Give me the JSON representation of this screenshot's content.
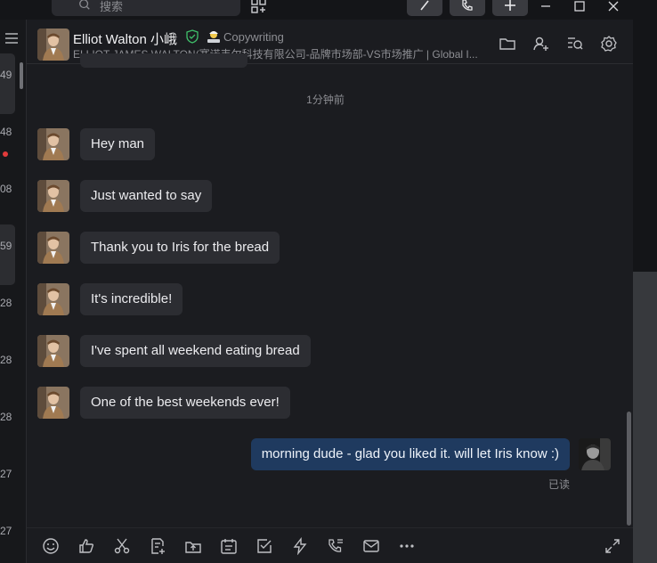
{
  "topbar": {
    "search_placeholder": "搜索",
    "icons": [
      "search-icon",
      "apps-add-icon",
      "pen-icon",
      "phone-call-icon",
      "plus-icon",
      "minimize-icon",
      "maximize-icon",
      "close-icon"
    ]
  },
  "left_list": {
    "numbers": [
      "49",
      "48",
      "08",
      "59",
      "28",
      "28",
      "28",
      "27",
      "27"
    ]
  },
  "chat": {
    "header": {
      "name": "Elliot Walton 小峨",
      "tag": "Copywriting",
      "subtitle": "ELLIOT JAMES WALTON(赛诺韦尔科技有限公司-品牌市场部-VS市场推广 | Global I..."
    },
    "time_separator": "1分钟前",
    "messages": [
      {
        "text": "Hey man"
      },
      {
        "text": "Just wanted to say"
      },
      {
        "text": "Thank you to Iris for the bread"
      },
      {
        "text": "It's incredible!"
      },
      {
        "text": "I've spent all weekend eating bread"
      },
      {
        "text": "One of the best weekends ever!"
      }
    ],
    "self_message": {
      "text": "morning dude - glad you liked it. will let Iris know :)",
      "status": "已读"
    }
  },
  "toolbar": {
    "icons": [
      "emoji-icon",
      "thumbs-up-icon",
      "scissors-icon",
      "doc-add-icon",
      "upload-icon",
      "calendar-icon",
      "checkbox-icon",
      "lightning-icon",
      "phone-list-icon",
      "mail-icon",
      "more-icon",
      "expand-icon"
    ]
  },
  "colors": {
    "background": "#1b1c20",
    "bubble": "#2c2d32",
    "self_bubble": "#1f3a5f",
    "badge_red": "#e23b3b",
    "verified_green": "#3fbf6a"
  }
}
